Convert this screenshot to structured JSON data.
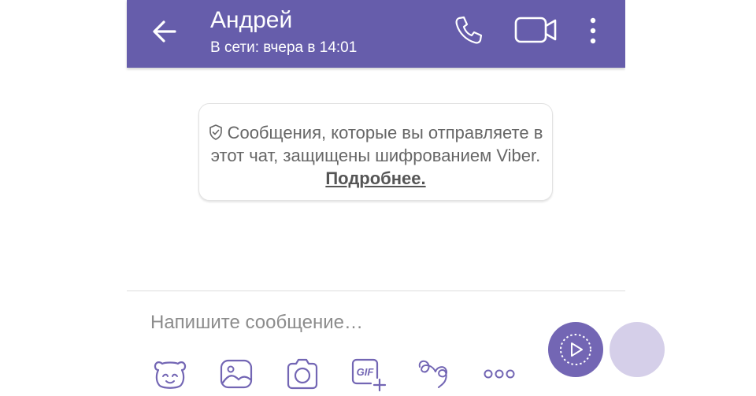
{
  "colors": {
    "header_bg": "#665dab",
    "accent": "#7366b4",
    "icon": "#7366b4"
  },
  "header": {
    "contact_name": "Андрей",
    "status": "В сети: вчера в 14:01",
    "icons": [
      "back-arrow-icon",
      "phone-icon",
      "video-camera-icon",
      "more-vertical-icon"
    ]
  },
  "notice": {
    "text": "Сообщения, которые вы отправляете в этот чат, защищены шифрованием Viber.",
    "link_label": "Подробнее.",
    "icon": "shield-icon"
  },
  "composer": {
    "placeholder": "Напишите сообщение…",
    "toolbar_icons": [
      "sticker-icon",
      "gallery-icon",
      "camera-icon",
      "gif-icon",
      "doodle-icon",
      "more-horizontal-icon"
    ],
    "gif_label": "GIF",
    "send_icon": "send-video-message-icon"
  }
}
